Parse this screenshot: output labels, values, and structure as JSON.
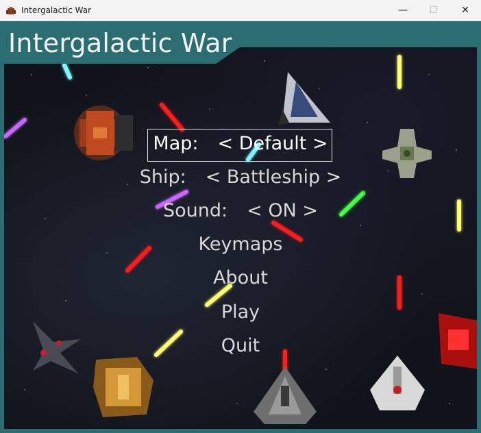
{
  "window": {
    "title": "Intergalactic War",
    "controls": {
      "minimize": "—",
      "maximize": "☐",
      "close": "✕"
    }
  },
  "header": {
    "title": "Intergalactic War"
  },
  "menu": {
    "map": {
      "label": "Map:",
      "value": "< Default >"
    },
    "ship": {
      "label": "Ship:",
      "value": "< Battleship >"
    },
    "sound": {
      "label": "Sound:",
      "value": "< ON >"
    },
    "keymaps": "Keymaps",
    "about": "About",
    "play": "Play",
    "quit": "Quit"
  },
  "colors": {
    "frame": "#2a6e72",
    "space": "#101319",
    "laser_red": "#ff1a1a",
    "laser_cyan": "#7ff6ff",
    "laser_yellow": "#ffff70",
    "laser_green": "#44ff44",
    "laser_purple": "#c866ff"
  },
  "icons": [
    "app-spaceship-icon",
    "minimize-icon",
    "maximize-icon",
    "close-icon"
  ]
}
